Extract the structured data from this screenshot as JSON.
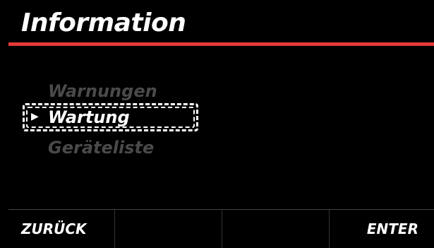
{
  "header": {
    "title": "Information"
  },
  "menu": {
    "items": [
      {
        "label": "Warnungen",
        "state": "inactive"
      },
      {
        "label": "Wartung",
        "state": "selected"
      },
      {
        "label": "Geräteliste",
        "state": "inactive"
      }
    ],
    "cursor_icon": "play-triangle-icon"
  },
  "footer": {
    "soft_keys": [
      {
        "label": "ZURÜCK"
      },
      {
        "label": ""
      },
      {
        "label": ""
      },
      {
        "label": "ENTER"
      }
    ]
  },
  "colors": {
    "background": "#000000",
    "accent_rule": "#e53935",
    "text_active": "#ffffff",
    "text_inactive": "#4a4a4a"
  }
}
